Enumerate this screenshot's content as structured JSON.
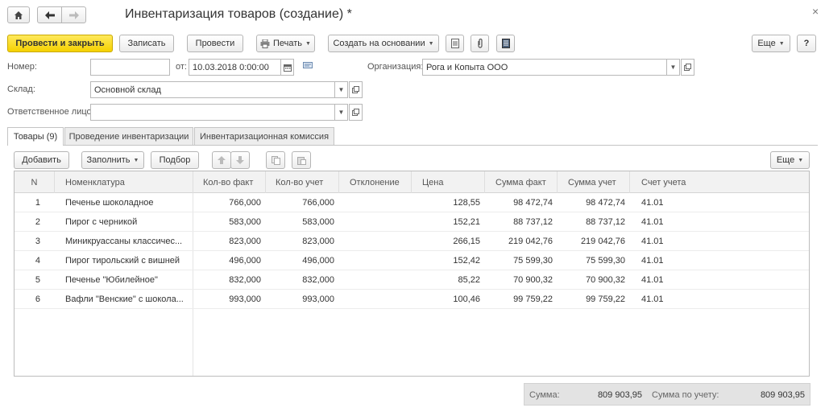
{
  "window": {
    "title": "Инвентаризация товаров (создание) *",
    "close_glyph": "×"
  },
  "nav": {
    "home_icon": "home-icon",
    "back_icon": "arrow-left-icon",
    "forward_icon": "arrow-right-icon"
  },
  "toolbar": {
    "post_close": "Провести и закрыть",
    "save": "Записать",
    "post": "Провести",
    "print": "Печать",
    "create_based": "Создать на основании",
    "more": "Еще",
    "help": "?"
  },
  "form": {
    "number_label": "Номер:",
    "number_value": "",
    "from_label": "от:",
    "date_value": "10.03.2018  0:00:00",
    "org_label": "Организация:",
    "org_value": "Рога и Копыта ООО",
    "warehouse_label": "Склад:",
    "warehouse_value": "Основной склад",
    "responsible_label": "Ответственное лицо:",
    "responsible_value": ""
  },
  "tabs": [
    {
      "label": "Товары (9)"
    },
    {
      "label": "Проведение инвентаризации"
    },
    {
      "label": "Инвентаризационная комиссия"
    }
  ],
  "grid_toolbar": {
    "add": "Добавить",
    "fill": "Заполнить",
    "select": "Подбор",
    "more": "Еще"
  },
  "columns": [
    "N",
    "Номенклатура",
    "Кол-во факт",
    "Кол-во учет",
    "Отклонение",
    "Цена",
    "Сумма факт",
    "Сумма учет",
    "Счет учета"
  ],
  "rows": [
    {
      "n": "1",
      "name": "Печенье шоколадное",
      "qty_fact": "766,000",
      "qty_acc": "766,000",
      "dev": "",
      "price": "128,55",
      "sum_fact": "98 472,74",
      "sum_acc": "98 472,74",
      "account": "41.01"
    },
    {
      "n": "2",
      "name": "Пирог с черникой",
      "qty_fact": "583,000",
      "qty_acc": "583,000",
      "dev": "",
      "price": "152,21",
      "sum_fact": "88 737,12",
      "sum_acc": "88 737,12",
      "account": "41.01"
    },
    {
      "n": "3",
      "name": "Миникруассаны классичес...",
      "qty_fact": "823,000",
      "qty_acc": "823,000",
      "dev": "",
      "price": "266,15",
      "sum_fact": "219 042,76",
      "sum_acc": "219 042,76",
      "account": "41.01"
    },
    {
      "n": "4",
      "name": "Пирог тирольский с вишней",
      "qty_fact": "496,000",
      "qty_acc": "496,000",
      "dev": "",
      "price": "152,42",
      "sum_fact": "75 599,30",
      "sum_acc": "75 599,30",
      "account": "41.01"
    },
    {
      "n": "5",
      "name": "Печенье \"Юбилейное\"",
      "qty_fact": "832,000",
      "qty_acc": "832,000",
      "dev": "",
      "price": "85,22",
      "sum_fact": "70 900,32",
      "sum_acc": "70 900,32",
      "account": "41.01"
    },
    {
      "n": "6",
      "name": "Вафли \"Венские\" с шокола...",
      "qty_fact": "993,000",
      "qty_acc": "993,000",
      "dev": "",
      "price": "100,46",
      "sum_fact": "99 759,22",
      "sum_acc": "99 759,22",
      "account": "41.01"
    }
  ],
  "footer": {
    "sum_label": "Сумма:",
    "sum_value": "809 903,95",
    "sum_acc_label": "Сумма по учету:",
    "sum_acc_value": "809 903,95"
  },
  "colors": {
    "primary_button": "#f5d100",
    "grid_header": "#f2f2f2",
    "footer_bg": "#e3e3e3"
  }
}
